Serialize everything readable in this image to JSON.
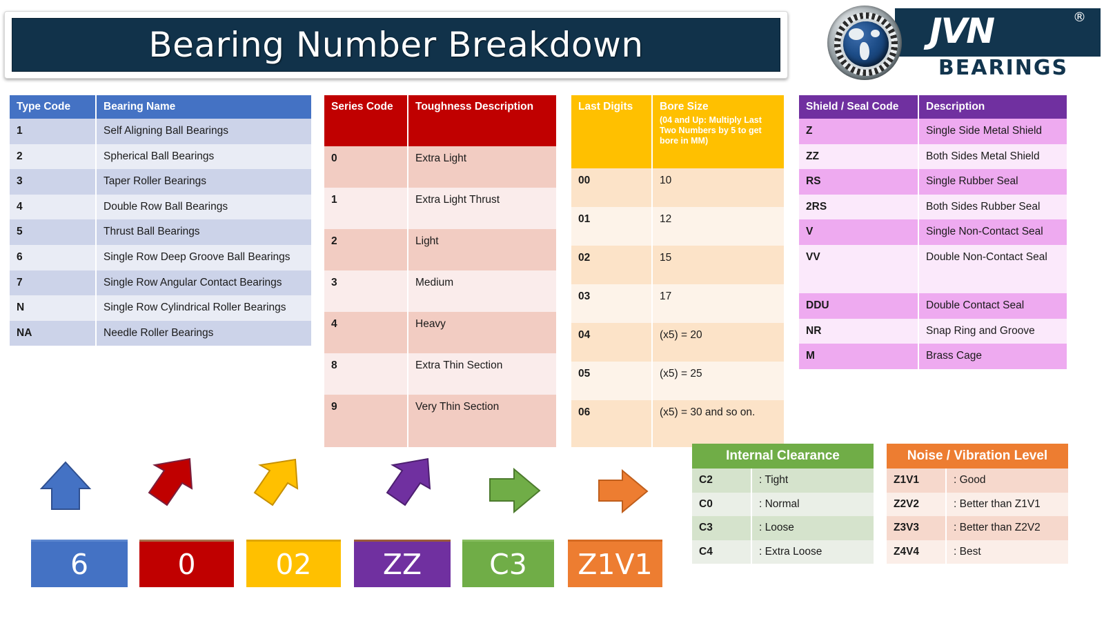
{
  "header": {
    "title": "Bearing Number Breakdown",
    "logo": {
      "brand": "JVN",
      "registered": "®",
      "subtitle": "BEARINGS"
    }
  },
  "tables": {
    "type_code": {
      "headers": [
        "Type Code",
        "Bearing Name"
      ],
      "header_color": "#4472c4",
      "rows": [
        [
          "1",
          "Self Aligning Ball Bearings"
        ],
        [
          "2",
          "Spherical Ball Bearings"
        ],
        [
          "3",
          "Taper Roller Bearings"
        ],
        [
          "4",
          "Double Row Ball Bearings"
        ],
        [
          "5",
          "Thrust Ball Bearings"
        ],
        [
          "6",
          "Single Row Deep Groove Ball Bearings"
        ],
        [
          "7",
          "Single Row Angular Contact Bearings"
        ],
        [
          "N",
          "Single Row Cylindrical Roller Bearings"
        ],
        [
          "NA",
          "Needle Roller Bearings"
        ]
      ]
    },
    "series_code": {
      "headers": [
        "Series Code",
        "Toughness Description"
      ],
      "header_color": "#c00000",
      "rows": [
        [
          "0",
          "Extra Light"
        ],
        [
          "1",
          "Extra Light Thrust"
        ],
        [
          "2",
          "Light"
        ],
        [
          "3",
          "Medium"
        ],
        [
          "4",
          "Heavy"
        ],
        [
          "8",
          "Extra Thin Section"
        ],
        [
          "9",
          "Very Thin Section"
        ]
      ]
    },
    "bore_size": {
      "headers": [
        "Last Digits",
        "Bore Size"
      ],
      "header_sub": "(04 and Up: Multiply Last Two Numbers by 5 to get bore in MM)",
      "header_color": "#ffc000",
      "rows": [
        [
          "00",
          "10"
        ],
        [
          "01",
          "12"
        ],
        [
          "02",
          "15"
        ],
        [
          "03",
          "17"
        ],
        [
          "04",
          "(x5) = 20"
        ],
        [
          "05",
          "(x5) = 25"
        ],
        [
          "06",
          "(x5) = 30 and so on."
        ]
      ]
    },
    "shield_seal": {
      "headers": [
        "Shield / Seal Code",
        "Description"
      ],
      "header_color": "#7030a0",
      "rows": [
        [
          "Z",
          "Single Side Metal Shield"
        ],
        [
          "ZZ",
          "Both Sides Metal Shield"
        ],
        [
          "RS",
          "Single Rubber Seal"
        ],
        [
          "2RS",
          "Both Sides Rubber Seal"
        ],
        [
          "V",
          "Single Non-Contact Seal"
        ],
        [
          "VV",
          "Double Non-Contact Seal"
        ],
        [
          "DDU",
          "Double Contact Seal"
        ],
        [
          "NR",
          "Snap Ring and Groove"
        ],
        [
          "M",
          "Brass Cage"
        ]
      ]
    },
    "internal_clearance": {
      "title": "Internal Clearance",
      "header_color": "#70ad47",
      "rows": [
        [
          "C2",
          ": Tight"
        ],
        [
          "C0",
          ": Normal"
        ],
        [
          "C3",
          ": Loose"
        ],
        [
          "C4",
          ": Extra Loose"
        ]
      ]
    },
    "noise_vibration": {
      "title": "Noise / Vibration Level",
      "header_color": "#ed7d31",
      "rows": [
        [
          "Z1V1",
          ": Good"
        ],
        [
          "Z2V2",
          ": Better than Z1V1"
        ],
        [
          "Z3V3",
          ": Better than Z2V2"
        ],
        [
          "Z4V4",
          ": Best"
        ]
      ]
    }
  },
  "example_breakdown": {
    "segments": [
      {
        "code": "6",
        "color": "#4472c4",
        "arrow": "arrow-up",
        "arrow_color": "#4472c4"
      },
      {
        "code": "0",
        "color": "#c00000",
        "arrow": "arrow-up-right",
        "arrow_color": "#c00000"
      },
      {
        "code": "02",
        "color": "#ffc000",
        "arrow": "arrow-up-right",
        "arrow_color": "#ffc000"
      },
      {
        "code": "ZZ",
        "color": "#7030a0",
        "arrow": "arrow-up-right",
        "arrow_color": "#7030a0"
      },
      {
        "code": "C3",
        "color": "#70ad47",
        "arrow": "arrow-right",
        "arrow_color": "#70ad47"
      },
      {
        "code": "Z1V1",
        "color": "#ed7d31",
        "arrow": "arrow-right",
        "arrow_color": "#ed7d31"
      }
    ]
  }
}
